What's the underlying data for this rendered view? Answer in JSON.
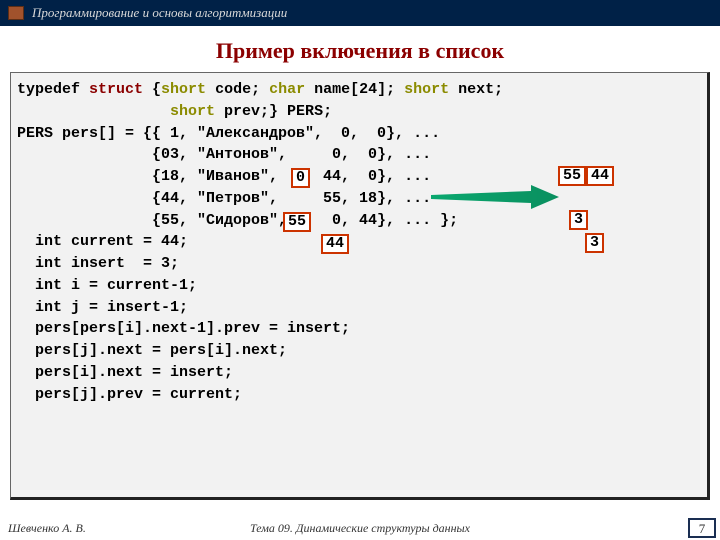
{
  "header": {
    "course_title": "Программирование и основы алгоритмизации"
  },
  "slide": {
    "title": "Пример включения в список"
  },
  "code": {
    "typedef_l1_a": "typedef ",
    "typedef_l1_b": "struct",
    "typedef_l1_c": " {",
    "typedef_l1_d": "short",
    "typedef_l1_e": " code; ",
    "typedef_l1_f": "char",
    "typedef_l1_g": " name[24]; ",
    "typedef_l1_h": "short",
    "typedef_l1_i": " next;",
    "typedef_l2_a": "                 ",
    "typedef_l2_b": "short",
    "typedef_l2_c": " prev;} PERS;",
    "blank1": "",
    "arr_l0": "PERS pers[] = {{ 1, \"Александров\",  0,  0}, ...",
    "arr_l1": "               {03, \"Антонов\",     0,  0}, ...",
    "arr_l2": "               {18, \"Иванов\",     44,  0}, ...",
    "arr_l3": "               {44, \"Петров\",     55, 18}, ...",
    "arr_l4": "               {55, \"Сидоров\",     0, 44}, ... };",
    "body_l1": "  int current = 44;",
    "body_l2": "  int insert  = 3;",
    "body_l3": "  int i = current-1;",
    "body_l4": "  int j = insert-1;",
    "body_l5": "  pers[pers[i].next-1].prev = insert;",
    "body_l6": "  pers[j].next = pers[i].next;",
    "body_l7": "  pers[i].next = insert;",
    "body_l8": "  pers[j].prev = current;"
  },
  "overlays": {
    "antonov_next": "0",
    "petrov_next": "55",
    "sidorov_prev": "44",
    "right_55": "55",
    "right_44": "44",
    "right_3_a": "3",
    "right_3_b": "3"
  },
  "footer": {
    "author": "Шевченко А. В.",
    "topic": "Тема 09. Динамические структуры данных",
    "page": "7"
  }
}
